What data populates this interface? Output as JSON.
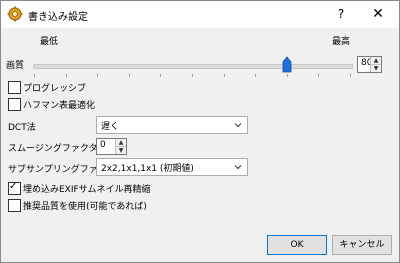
{
  "window": {
    "title": "書き込み設定",
    "help_label": "?",
    "close_label": "✕",
    "icon": "gear-app-icon"
  },
  "quality": {
    "min_label": "最低",
    "max_label": "最高",
    "label": "画質",
    "value": "80",
    "slider_fraction": 0.8
  },
  "checkboxes": {
    "progressive": {
      "label": "プログレッシブ",
      "checked": false
    },
    "huffman": {
      "label": "ハフマン表最適化",
      "checked": false
    },
    "embed_exif": {
      "label": "埋め込みEXIFサムネイル再精縮",
      "checked": true
    },
    "recommended_quality": {
      "label": "推奨品質を使用(可能であれば)",
      "checked": false
    }
  },
  "dct": {
    "label": "DCT法",
    "value": "遅く"
  },
  "smoothing": {
    "label": "スムージングファクタ",
    "value": "0"
  },
  "subsampling": {
    "label": "サブサンプリングファクタ",
    "value": "2x2,1x1,1x1 (初期値)"
  },
  "buttons": {
    "ok": "OK",
    "cancel": "キャンセル"
  },
  "colors": {
    "accent": "#0078d7",
    "thumb": "#1e6fd9"
  }
}
